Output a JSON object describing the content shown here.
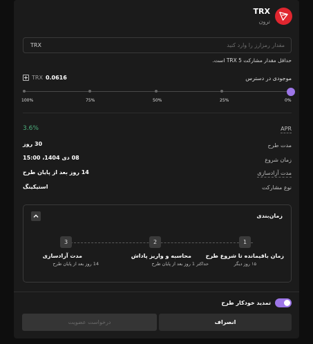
{
  "header": {
    "symbol": "TRX",
    "name": "ترون",
    "logo_icon": "tron-logo-icon",
    "logo_color": "#e0262f"
  },
  "amount_input": {
    "placeholder": "مقدار رمزارز را وارد کنید",
    "unit": "TRX"
  },
  "min_note": "حداقل مقدار مشارکت TRX 5 است.",
  "balance": {
    "label": "موجودی در دسترس",
    "value": "0.0616",
    "unit": "TRX"
  },
  "slider": {
    "value_fraction": 0,
    "labels": [
      "100%",
      "75%",
      "50%",
      "25%",
      "0%"
    ],
    "accent": "#9d76e8"
  },
  "info": {
    "apr_label": "APR",
    "apr_value": "3.6%",
    "duration_label": "مدت طرح",
    "duration_value": "30 روز",
    "start_label": "زمان شروع",
    "start_value": "08 دی 1404، 15:00",
    "release_label": "مدت آزادسازی",
    "release_value": "14 روز بعد از پایان طرح",
    "type_label": "نوع مشارکت",
    "type_value": "استیکینگ"
  },
  "timeline": {
    "title": "زمان‌بندی",
    "steps": [
      {
        "num": "1",
        "title": "زمان باقیمانده تا شروع طرح",
        "desc": "۱۵ روز دیگر"
      },
      {
        "num": "2",
        "title": "محاسبه و واریز پاداش",
        "desc": "حداکثر 1 روز بعد از پایان طرح"
      },
      {
        "num": "3",
        "title": "مدت آزادسازی",
        "desc": "14 روز بعد از پایان طرح"
      }
    ]
  },
  "footer": {
    "auto_renew_label": "تمدید خودکار طرح",
    "auto_renew_on": true,
    "cancel_label": "انصراف",
    "submit_label": "درخواست عضویت"
  }
}
